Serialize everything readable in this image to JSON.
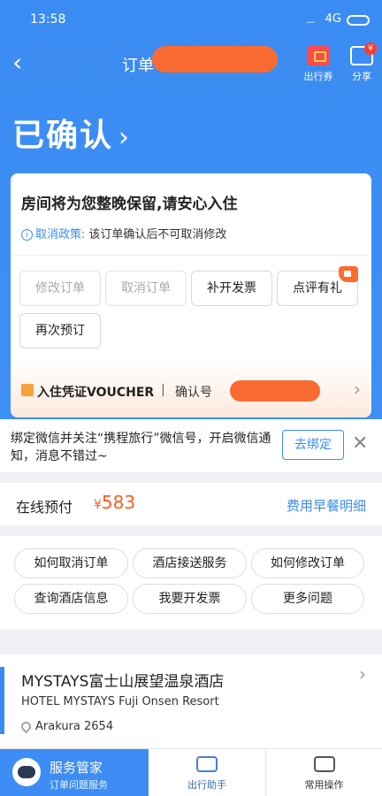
{
  "status_bar": {
    "time": "13:58",
    "signal": "....",
    "network": "4G"
  },
  "nav": {
    "title": "订单",
    "ticket_label": "出行券",
    "share_label": "分享",
    "share_badge": "¥"
  },
  "order_status": {
    "title": "已确认",
    "chevron": "›"
  },
  "card": {
    "headline": "房间将为您整晚保留,请安心入住",
    "policy_label": "取消政策:",
    "policy_text": "该订单确认后不可取消修改",
    "buttons": [
      {
        "label": "修改订单",
        "enabled": false
      },
      {
        "label": "取消订单",
        "enabled": false
      },
      {
        "label": "补开发票",
        "enabled": true
      },
      {
        "label": "点评有礼",
        "enabled": true
      },
      {
        "label": "再次预订",
        "enabled": true
      }
    ],
    "voucher_label": "入住凭证VOUCHER",
    "voucher_sep": "|",
    "confirmation_label": "确认号"
  },
  "wechat": {
    "text": "绑定微信并关注“携程旅行”微信号，开启微信通知，消息不错过~",
    "bind_label": "去绑定",
    "close": "✕"
  },
  "payment": {
    "label": "在线预付",
    "currency": "¥",
    "amount": "583",
    "detail_link": "费用早餐明细"
  },
  "faq": [
    "如何取消订单",
    "酒店接送服务",
    "如何修改订单",
    "查询酒店信息",
    "我要开发票",
    "更多问题"
  ],
  "hotel": {
    "name": "MYSTAYS富士山展望温泉酒店",
    "name_en": "HOTEL MYSTAYS Fuji Onsen Resort",
    "address": "Arakura 2654"
  },
  "tabbar": {
    "service_title": "服务管家",
    "service_sub": "订单问题服务",
    "helper": "出行助手",
    "common": "常用操作"
  }
}
